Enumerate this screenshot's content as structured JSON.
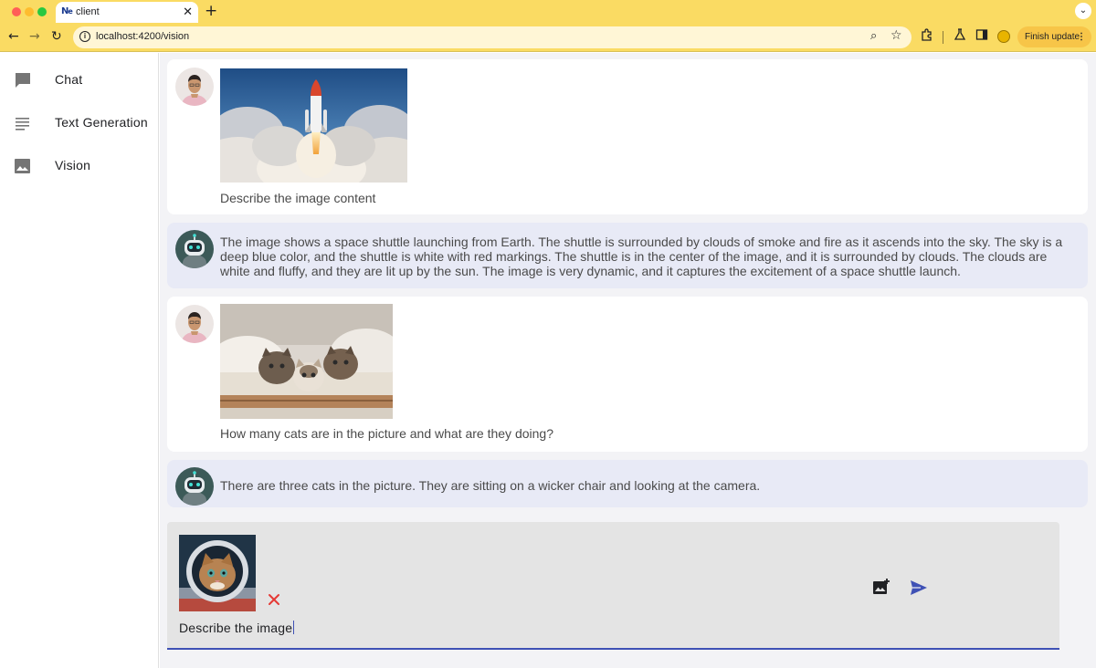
{
  "browser": {
    "tab_title": "client",
    "tab_favicon": "N",
    "url": "localhost:4200/vision",
    "finish_update_label": "Finish update",
    "icons": [
      "back-icon",
      "forward-icon",
      "reload-icon",
      "info-icon",
      "zoom-icon",
      "star-icon",
      "extensions-icon",
      "labs-icon",
      "side-panel-icon",
      "profile-icon",
      "more-icon"
    ]
  },
  "sidebar": {
    "items": [
      {
        "label": "Chat",
        "icon": "chat-icon"
      },
      {
        "label": "Text Generation",
        "icon": "text-lines-icon"
      },
      {
        "label": "Vision",
        "icon": "image-icon"
      }
    ]
  },
  "conversation": {
    "messages": [
      {
        "role": "user",
        "image": "space-shuttle-launch-photo",
        "text": "Describe the image content"
      },
      {
        "role": "bot",
        "text": "The image shows a space shuttle launching from Earth. The shuttle is surrounded by clouds of smoke and fire as it ascends into the sky. The sky is a deep blue color, and the shuttle is white with red markings. The shuttle is in the center of the image, and it is surrounded by clouds. The clouds are white and fluffy, and they are lit up by the sun. The image is very dynamic, and it captures the excitement of a space shuttle launch."
      },
      {
        "role": "user",
        "image": "three-kittens-photo",
        "text": "How many cats are in the picture and what are they doing?"
      },
      {
        "role": "bot",
        "text": "There are three cats in the picture. They are sitting on a wicker chair and looking at the camera."
      }
    ]
  },
  "composer": {
    "attached_image": "astronaut-cat-photo",
    "input_value": "Describe the image",
    "remove_color": "#e53935",
    "accent_color": "#3f51b5"
  }
}
